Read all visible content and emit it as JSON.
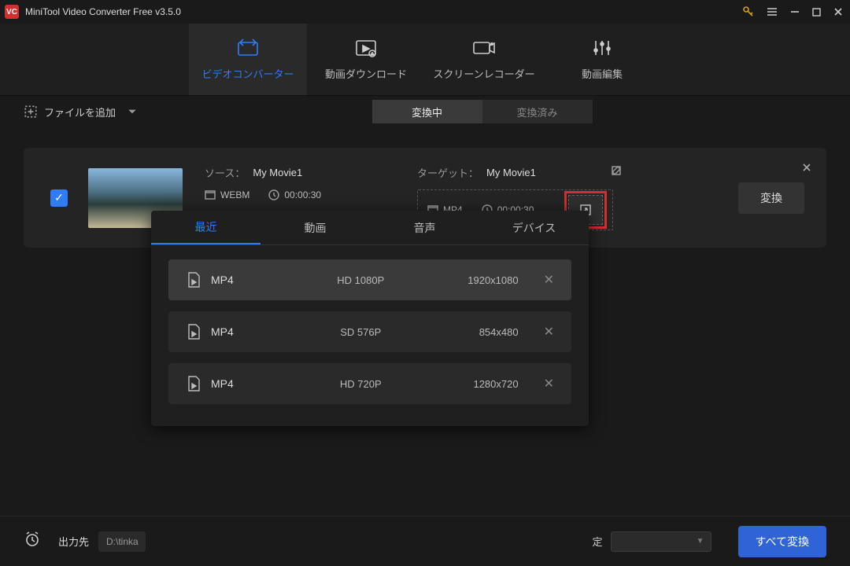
{
  "titlebar": {
    "title": "MiniTool Video Converter Free v3.5.0"
  },
  "maintabs": [
    {
      "label": "ビデオコンバーター",
      "active": true
    },
    {
      "label": "動画ダウンロード"
    },
    {
      "label": "スクリーンレコーダー"
    },
    {
      "label": "動画編集"
    }
  ],
  "toolbar": {
    "add_file": "ファイルを追加",
    "converting": "変換中",
    "converted": "変換済み"
  },
  "card": {
    "source_label": "ソース：",
    "source_name": "My Movie1",
    "source_format": "WEBM",
    "source_duration": "00:00:30",
    "target_label": "ターゲット：",
    "target_name": "My Movie1",
    "target_format": "MP4",
    "target_duration": "00:00:30",
    "convert": "変換"
  },
  "popup": {
    "tabs": [
      "最近",
      "動画",
      "音声",
      "デバイス"
    ],
    "items": [
      {
        "format": "MP4",
        "quality": "HD 1080P",
        "resolution": "1920x1080"
      },
      {
        "format": "MP4",
        "quality": "SD 576P",
        "resolution": "854x480"
      },
      {
        "format": "MP4",
        "quality": "HD 720P",
        "resolution": "1280x720"
      }
    ]
  },
  "footer": {
    "out_label": "出力先",
    "out_path": "D:\\tinka",
    "setting_suffix": "定",
    "convert_all": "すべて変換"
  }
}
